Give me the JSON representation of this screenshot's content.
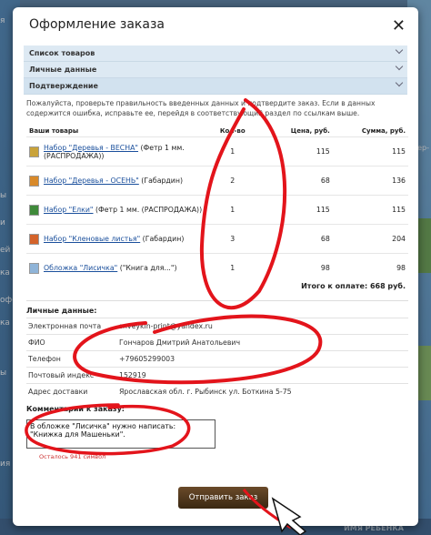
{
  "background": {
    "left_labels": [
      "я",
      "ы",
      "и",
      "ей",
      "ка",
      "офе",
      "ка",
      "ы",
      "ия"
    ],
    "right_labels": [
      "тер-"
    ],
    "bottom_labels": [
      "ИМЯ РЕБЁНКА"
    ]
  },
  "dialog": {
    "title": "Оформление заказа",
    "close": "✕",
    "accordion": [
      "Список товаров",
      "Личные данные",
      "Подтверждение"
    ],
    "intro": "Пожалуйста, проверьте правильность введенных данных и подтвердите заказ. Если в данных содержится ошибка, исправьте ее, перейдя в соответствующий раздел по ссылкам выше."
  },
  "items_table": {
    "headers": [
      "Ваши товары",
      "Кол-во",
      "Цена, руб.",
      "Сумма, руб."
    ],
    "rows": [
      {
        "link": "Набор \"Деревья - ВЕСНА\"",
        "rest": " (Фетр 1 мм. (РАСПРОДАЖА))",
        "qty": "1",
        "price": "115",
        "sum": "115",
        "thumb_color": "#c9a33a"
      },
      {
        "link": "Набор \"Деревья - ОСЕНЬ\"",
        "rest": " (Габардин)",
        "qty": "2",
        "price": "68",
        "sum": "136",
        "thumb_color": "#d98a2a"
      },
      {
        "link": "Набор \"Елки\"",
        "rest": " (Фетр 1 мм. (РАСПРОДАЖА))",
        "qty": "1",
        "price": "115",
        "sum": "115",
        "thumb_color": "#3f8a3a"
      },
      {
        "link": "Набор \"Кленовые листья\"",
        "rest": " (Габардин)",
        "qty": "3",
        "price": "68",
        "sum": "204",
        "thumb_color": "#d4632a"
      },
      {
        "link": "Обложка \"Лисичка\"",
        "rest": " (\"Книга для...\")",
        "qty": "1",
        "price": "98",
        "sum": "98",
        "thumb_color": "#8fb4d8"
      }
    ],
    "total": "Итого к оплате: 668 руб."
  },
  "personal": {
    "heading": "Личные данные:",
    "fields": [
      {
        "label": "Электронная почта",
        "value": "snveykin-print@yandex.ru"
      },
      {
        "label": "ФИО",
        "value": "Гончаров Дмитрий Анатольевич"
      },
      {
        "label": "Телефон",
        "value": "+79605299003"
      },
      {
        "label": "Почтовый индекс",
        "value": "152919"
      },
      {
        "label": "Адрес доставки",
        "value": "Ярославская обл. г. Рыбинск ул. Боткина 5-75"
      }
    ]
  },
  "comment": {
    "heading": "Комментарий к заказу:",
    "value": "В обложке \"Лисичка\" нужно написать:\n\"Книжка для Машеньки\".",
    "remaining": "Осталось 941 символ"
  },
  "submit_label": "Отправить заказ",
  "colors": {
    "accent_link": "#1a4f9c",
    "annotation": "#e3141b",
    "button": "#4a3218"
  }
}
